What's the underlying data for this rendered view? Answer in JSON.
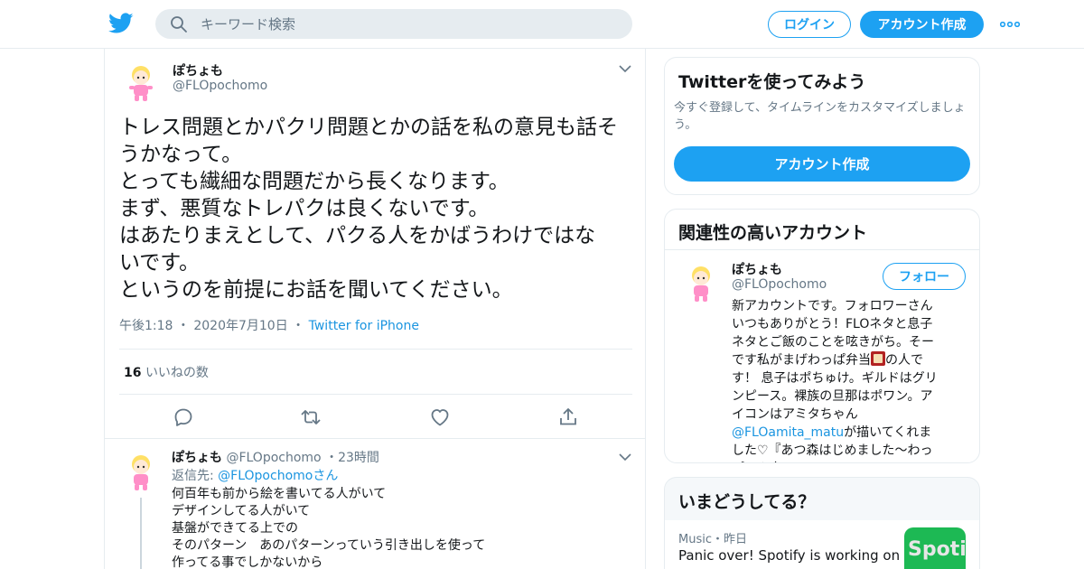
{
  "header": {
    "search_placeholder": "キーワード検索",
    "login_label": "ログイン",
    "signup_label": "アカウント作成"
  },
  "tweet": {
    "name": "ぽちょも",
    "handle": "@FLOpochomo",
    "lines": [
      "トレス問題とかパクリ問題とかの話を私の意見も話そ",
      "うかなって。",
      "とっても繊細な問題だから長くなります。",
      "まず、悪質なトレパクは良くないです。",
      "はあたりまえとして、パクる人をかばうわけではな",
      "いです。",
      "というのを前提にお話を聞いてください。"
    ],
    "time": "午後1:18",
    "date": "2020年7月10日",
    "source": "Twitter for iPhone",
    "likes_count": "16",
    "likes_label": "いいねの数"
  },
  "reply": {
    "name": "ぽちょも",
    "handle": "@FLOpochomo",
    "age": "23時間",
    "reply_prefix": "返信先:",
    "reply_handle": "@FLOpochomo",
    "reply_suffix": "さん",
    "lines": [
      "何百年も前から絵を書いてる人がいて",
      "デザインしてる人がいて",
      "基盤ができてる上での",
      "そのパターン　あのパターンっていう引き出しを使って",
      "作ってる事でしかないから"
    ]
  },
  "signup_card": {
    "title": "Twitterを使ってみよう",
    "subtitle": "今すぐ登録して、タイムラインをカスタマイズしましょう。",
    "button": "アカウント作成"
  },
  "related": {
    "title": "関連性の高いアカウント",
    "name": "ぽちょも",
    "handle": "@FLOpochomo",
    "follow_label": "フォロー",
    "bio_1": "新アカウントです。フォロワーさんいつもありがとう！FLOネタと息子ネタとご飯のことを呟きがち。そーです私がまげわっぱ弁当",
    "bio_2": "の人です！ 息子はポちゅけ。ギルドはグリンピース。裸族の旦那はポワン。アイコンはアミタちゃん",
    "bio_link": "@FLOamita_matu",
    "bio_3": "が描いてくれました♡『あつ森はじめました～わっぱべん島』"
  },
  "trends": {
    "title": "いまどうしてる？",
    "item_meta": "Music・昨日",
    "item_title": "Panic over! Spotify is working on",
    "thumb_text": "Spoti"
  },
  "colors": {
    "accent": "#1da1f2",
    "link": "#1b95e0",
    "muted": "#657786",
    "border": "#e6ecf0"
  }
}
